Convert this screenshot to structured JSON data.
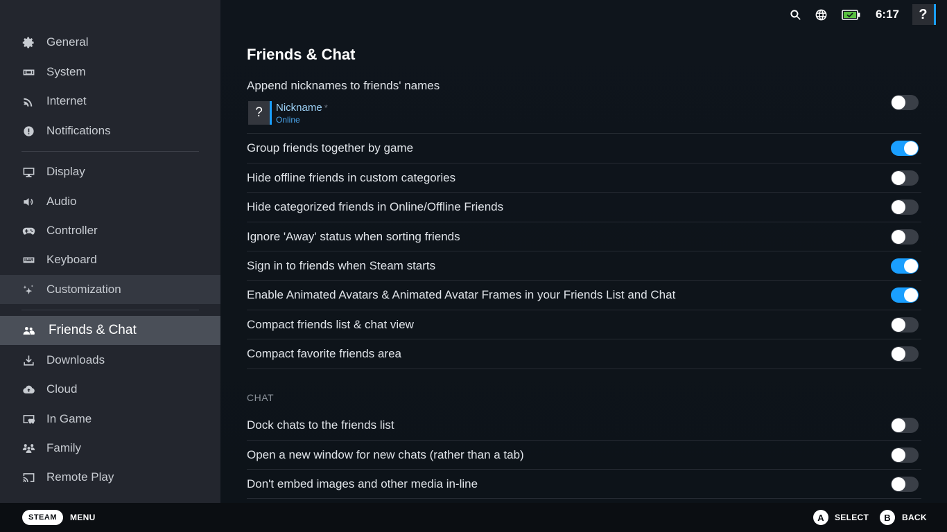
{
  "sidebar": {
    "items": [
      {
        "label": "General",
        "icon": "gear-icon"
      },
      {
        "label": "System",
        "icon": "system-icon"
      },
      {
        "label": "Internet",
        "icon": "wifi-icon"
      },
      {
        "label": "Notifications",
        "icon": "alert-icon"
      },
      {
        "label": "Display",
        "icon": "monitor-icon"
      },
      {
        "label": "Audio",
        "icon": "speaker-icon"
      },
      {
        "label": "Controller",
        "icon": "gamepad-icon"
      },
      {
        "label": "Keyboard",
        "icon": "keyboard-icon"
      },
      {
        "label": "Customization",
        "icon": "sparkle-icon"
      },
      {
        "label": "Friends & Chat",
        "icon": "friends-icon"
      },
      {
        "label": "Downloads",
        "icon": "download-icon"
      },
      {
        "label": "Cloud",
        "icon": "cloud-icon"
      },
      {
        "label": "In Game",
        "icon": "in-game-icon"
      },
      {
        "label": "Family",
        "icon": "family-icon"
      },
      {
        "label": "Remote Play",
        "icon": "cast-icon"
      }
    ],
    "active_index": 9
  },
  "topbar": {
    "clock": "6:17",
    "help_label": "?",
    "battery_color": "#59bf40"
  },
  "main": {
    "title": "Friends & Chat",
    "nickname_setting": {
      "label": "Append nicknames to friends' names",
      "avatar_glyph": "?",
      "nickname": "Nickname",
      "nickname_mark": "*",
      "status": "Online",
      "enabled": false
    },
    "settings": [
      {
        "label": "Group friends together by game",
        "enabled": true
      },
      {
        "label": "Hide offline friends in custom categories",
        "enabled": false
      },
      {
        "label": "Hide categorized friends in Online/Offline Friends",
        "enabled": false
      },
      {
        "label": "Ignore 'Away' status when sorting friends",
        "enabled": false
      },
      {
        "label": "Sign in to friends when Steam starts",
        "enabled": true
      },
      {
        "label": "Enable Animated Avatars & Animated Avatar Frames in your Friends List and Chat",
        "enabled": true
      },
      {
        "label": "Compact friends list & chat view",
        "enabled": false
      },
      {
        "label": "Compact favorite friends area",
        "enabled": false
      }
    ],
    "chat_section": {
      "heading": "CHAT",
      "settings": [
        {
          "label": "Dock chats to the friends list",
          "enabled": false
        },
        {
          "label": "Open a new window for new chats (rather than a tab)",
          "enabled": false
        },
        {
          "label": "Don't embed images and other media in-line",
          "enabled": false
        }
      ]
    }
  },
  "footer": {
    "steam_label": "STEAM",
    "menu_label": "MENU",
    "a_glyph": "A",
    "select_label": "SELECT",
    "b_glyph": "B",
    "back_label": "BACK"
  },
  "colors": {
    "accent": "#1a9fff",
    "sidebar_bg": "#23262e",
    "main_bg": "#0e141b"
  }
}
